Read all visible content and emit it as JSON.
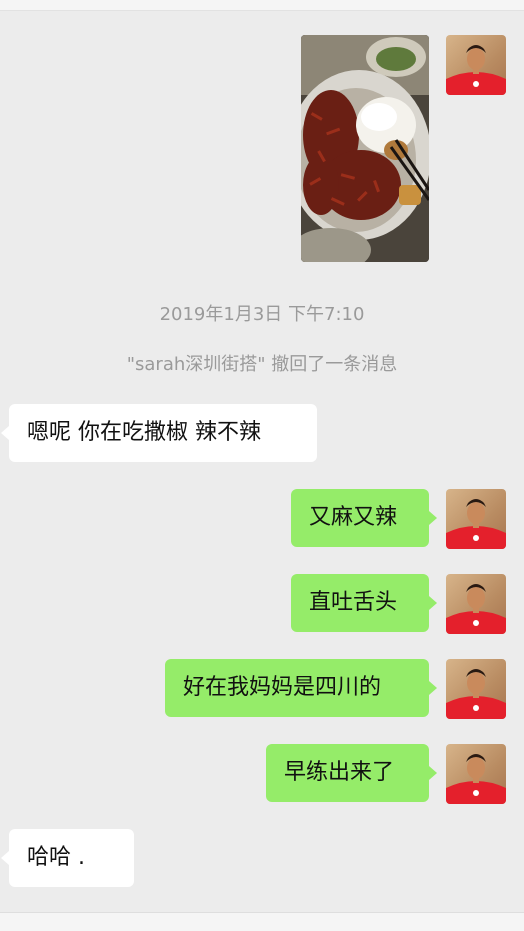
{
  "chat": {
    "timestamp": "2019年1月3日 下午7:10",
    "recall_notice": "\"sarah深圳街搭\" 撤回了一条消息",
    "messages": [
      {
        "side": "left",
        "text": "嗯呢 你在吃撒椒  辣不辣"
      },
      {
        "side": "right",
        "text": "又麻又辣"
      },
      {
        "side": "right",
        "text": "直吐舌头"
      },
      {
        "side": "right",
        "text": "好在我妈妈是四川的"
      },
      {
        "side": "right",
        "text": "早练出来了"
      },
      {
        "side": "left",
        "text": "哈哈 ."
      }
    ]
  },
  "colors": {
    "sent_bubble": "#95ec69",
    "received_bubble": "#ffffff",
    "chat_background": "#ececec",
    "system_text": "#9a9a9a"
  }
}
